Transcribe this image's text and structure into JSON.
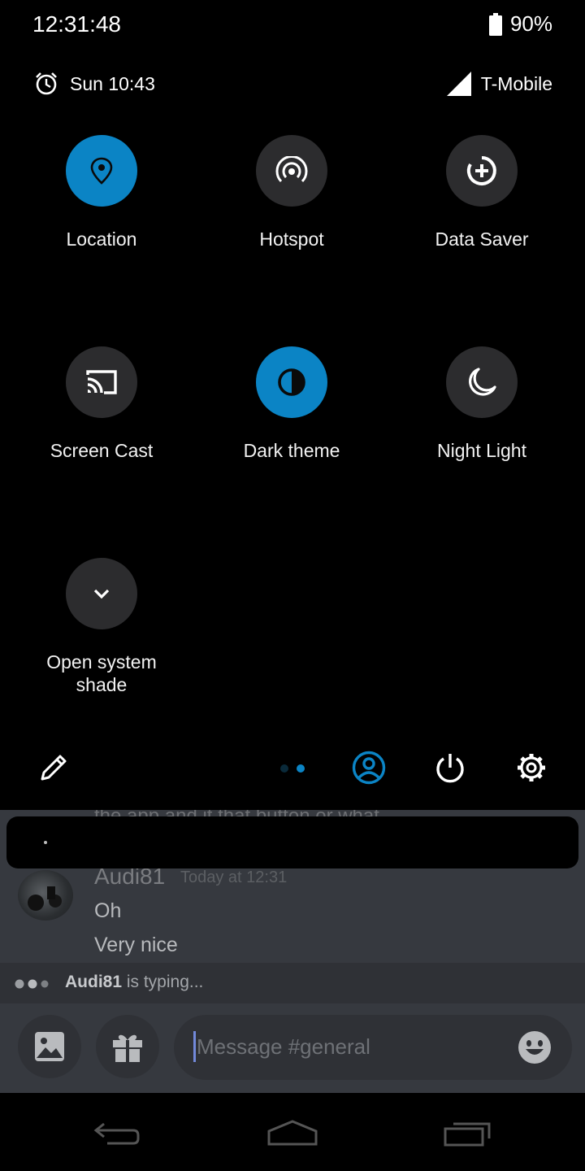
{
  "status_bar": {
    "time": "12:31:48",
    "battery": "90%",
    "battery_icon": "battery-icon"
  },
  "qs_header": {
    "alarm": "Sun 10:43",
    "carrier": "T-Mobile"
  },
  "tiles": [
    {
      "label": "Location",
      "icon": "location-icon",
      "active": true
    },
    {
      "label": "Hotspot",
      "icon": "hotspot-icon",
      "active": false
    },
    {
      "label": "Data Saver",
      "icon": "data-saver-icon",
      "active": false
    },
    {
      "label": "Screen Cast",
      "icon": "cast-icon",
      "active": false
    },
    {
      "label": "Dark theme",
      "icon": "dark-theme-icon",
      "active": true
    },
    {
      "label": "Night Light",
      "icon": "moon-icon",
      "active": false
    },
    {
      "label": "Open system shade",
      "icon": "chevron-down-icon",
      "active": false
    }
  ],
  "qs_footer": {
    "edit_icon": "pencil-icon",
    "user_icon": "user-icon",
    "power_icon": "power-icon",
    "settings_icon": "gear-icon"
  },
  "chat": {
    "author": "Audi81",
    "timestamp": "Today at 12:31",
    "messages": [
      "Oh",
      "Very nice"
    ],
    "typing_user": "Audi81",
    "typing_suffix": " is typing..."
  },
  "composer": {
    "placeholder": "Message #general"
  },
  "colors": {
    "accent": "#0b84c5",
    "tile_bg": "#2c2c2e",
    "chat_bg": "#36393f"
  }
}
